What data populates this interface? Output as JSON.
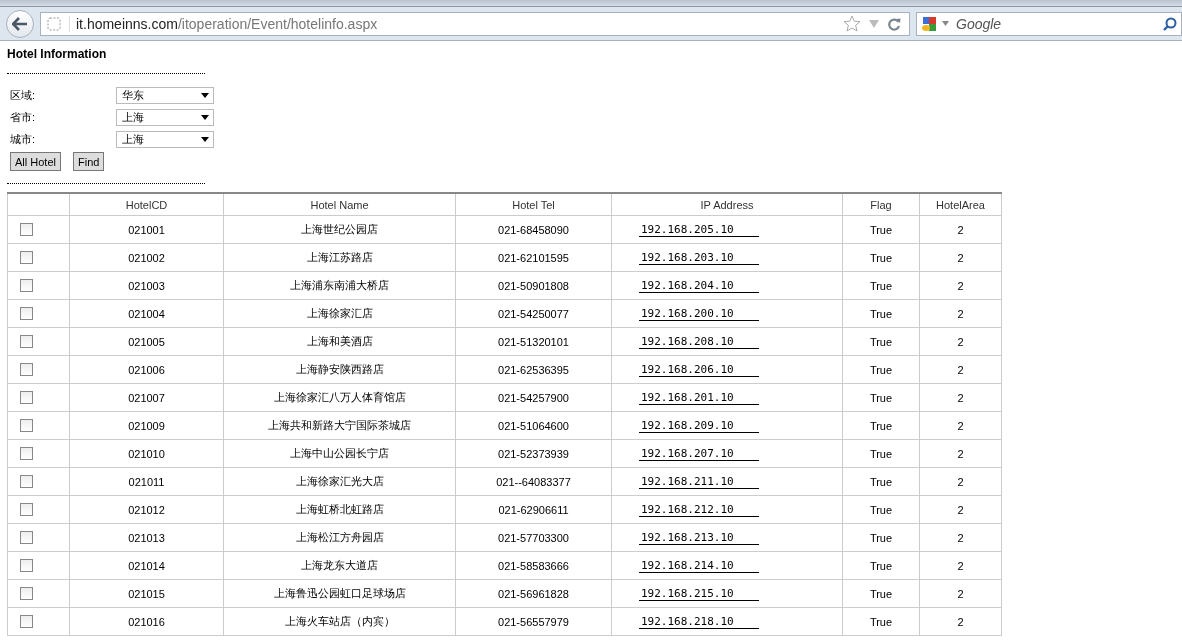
{
  "browser": {
    "url_host": "it.homeinns.com",
    "url_path": "/itoperation/Event/hotelinfo.aspx",
    "search_placeholder": "Google"
  },
  "page": {
    "title": "Hotel Information",
    "filters": [
      {
        "label": "区域:",
        "value": "华东"
      },
      {
        "label": "省市:",
        "value": "上海"
      },
      {
        "label": "城市:",
        "value": "上海"
      }
    ],
    "buttons": [
      "All Hotel",
      "Find"
    ]
  },
  "table": {
    "columns": [
      "HotelCD",
      "Hotel Name",
      "Hotel Tel",
      "IP Address",
      "Flag",
      "HotelArea"
    ],
    "rows": [
      {
        "checked": false,
        "code": "021001",
        "name": "上海世纪公园店",
        "tel": "021-68458090",
        "ip": "192.168.205.10",
        "flag": "True",
        "area": "2"
      },
      {
        "checked": false,
        "code": "021002",
        "name": "上海江苏路店",
        "tel": "021-62101595",
        "ip": "192.168.203.10",
        "flag": "True",
        "area": "2"
      },
      {
        "checked": false,
        "code": "021003",
        "name": "上海浦东南浦大桥店",
        "tel": "021-50901808",
        "ip": "192.168.204.10",
        "flag": "True",
        "area": "2"
      },
      {
        "checked": false,
        "code": "021004",
        "name": "上海徐家汇店",
        "tel": "021-54250077",
        "ip": "192.168.200.10",
        "flag": "True",
        "area": "2"
      },
      {
        "checked": false,
        "code": "021005",
        "name": "上海和美酒店",
        "tel": "021-51320101",
        "ip": "192.168.208.10",
        "flag": "True",
        "area": "2"
      },
      {
        "checked": false,
        "code": "021006",
        "name": "上海静安陕西路店",
        "tel": "021-62536395",
        "ip": "192.168.206.10",
        "flag": "True",
        "area": "2"
      },
      {
        "checked": false,
        "code": "021007",
        "name": "上海徐家汇八万人体育馆店",
        "tel": "021-54257900",
        "ip": "192.168.201.10",
        "flag": "True",
        "area": "2"
      },
      {
        "checked": false,
        "code": "021009",
        "name": "上海共和新路大宁国际茶城店",
        "tel": "021-51064600",
        "ip": "192.168.209.10",
        "flag": "True",
        "area": "2"
      },
      {
        "checked": false,
        "code": "021010",
        "name": "上海中山公园长宁店",
        "tel": "021-52373939",
        "ip": "192.168.207.10",
        "flag": "True",
        "area": "2"
      },
      {
        "checked": false,
        "code": "021011",
        "name": "上海徐家汇光大店",
        "tel": "021--64083377",
        "ip": "192.168.211.10",
        "flag": "True",
        "area": "2"
      },
      {
        "checked": false,
        "code": "021012",
        "name": "上海虹桥北虹路店",
        "tel": "021-62906611",
        "ip": "192.168.212.10",
        "flag": "True",
        "area": "2"
      },
      {
        "checked": false,
        "code": "021013",
        "name": "上海松江方舟园店",
        "tel": "021-57703300",
        "ip": "192.168.213.10",
        "flag": "True",
        "area": "2"
      },
      {
        "checked": false,
        "code": "021014",
        "name": "上海龙东大道店",
        "tel": "021-58583666",
        "ip": "192.168.214.10",
        "flag": "True",
        "area": "2"
      },
      {
        "checked": false,
        "code": "021015",
        "name": "上海鲁迅公园虹口足球场店",
        "tel": "021-56961828",
        "ip": "192.168.215.10",
        "flag": "True",
        "area": "2"
      },
      {
        "checked": false,
        "code": "021016",
        "name": "上海火车站店（内宾）",
        "tel": "021-56557979",
        "ip": "192.168.218.10",
        "flag": "True",
        "area": "2"
      }
    ]
  }
}
